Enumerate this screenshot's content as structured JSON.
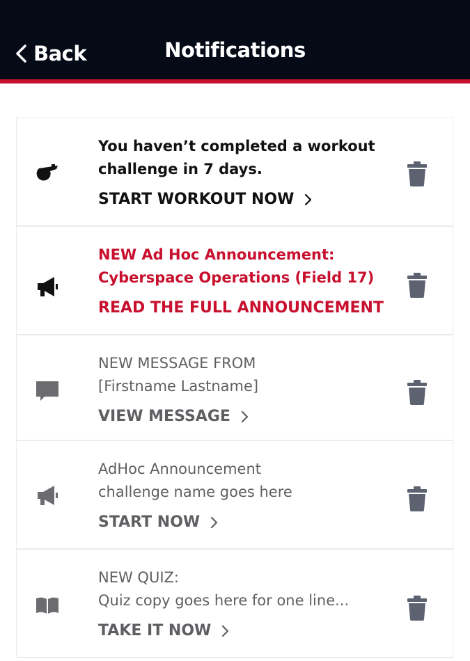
{
  "header": {
    "back_label": "Back",
    "title": "Notifications"
  },
  "colors": {
    "header_bg": "#050a17",
    "accent_red": "#c8102e",
    "text_dark": "#111111",
    "text_gray": "#5f5f63",
    "trash_gray": "#5c6270"
  },
  "notifications": [
    {
      "icon": "whistle-icon",
      "lines": [
        "You haven’t completed a workout",
        "challenge in 7 days."
      ],
      "cta": "START WORKOUT NOW"
    },
    {
      "icon": "megaphone-icon",
      "lines": [
        "NEW Ad Hoc Announcement:",
        "Cyberspace Operations (Field 17)"
      ],
      "cta": "READ THE FULL ANNOUNCEMENT"
    },
    {
      "icon": "chat-bubble-icon",
      "lines": [
        "NEW MESSAGE FROM",
        "[Firstname Lastname]"
      ],
      "cta": "VIEW MESSAGE"
    },
    {
      "icon": "megaphone-icon",
      "lines": [
        "AdHoc Announcement",
        "challenge name goes here"
      ],
      "cta": "START NOW"
    },
    {
      "icon": "book-icon",
      "lines": [
        "NEW QUIZ:",
        "Quiz copy goes here for one line..."
      ],
      "cta": "TAKE IT NOW"
    }
  ]
}
